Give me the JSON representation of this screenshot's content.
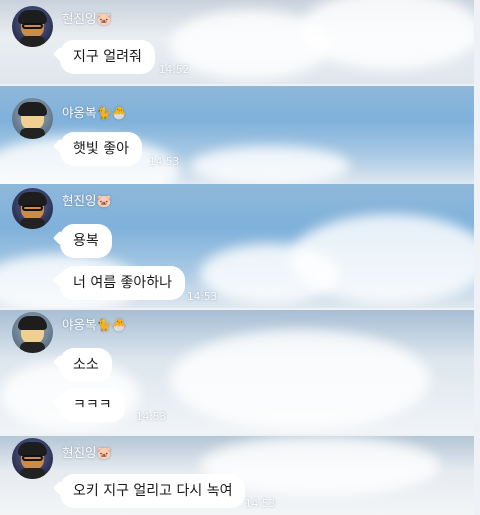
{
  "users": {
    "hyunjin": {
      "name": "현진잉",
      "emoji": "🐷"
    },
    "yongbok": {
      "name": "야옹복",
      "emoji": "🐈🐣"
    }
  },
  "groups": [
    {
      "sender": "hyunjin",
      "messages": [
        {
          "text": "지구 얼려줘"
        }
      ],
      "time": "14:52"
    },
    {
      "sender": "yongbok",
      "messages": [
        {
          "text": "햇빛 좋아"
        }
      ],
      "time": "14:53"
    },
    {
      "sender": "hyunjin",
      "messages": [
        {
          "text": "용복"
        },
        {
          "text": "너 여름 좋아하나"
        }
      ],
      "time": "14:53"
    },
    {
      "sender": "yongbok",
      "messages": [
        {
          "text": "소소"
        },
        {
          "text": "ㅋㅋㅋ"
        }
      ],
      "time": "14:53"
    },
    {
      "sender": "hyunjin",
      "messages": [
        {
          "text": "오키 지구 얼리고 다시 녹여"
        }
      ],
      "time": "14:53"
    }
  ]
}
